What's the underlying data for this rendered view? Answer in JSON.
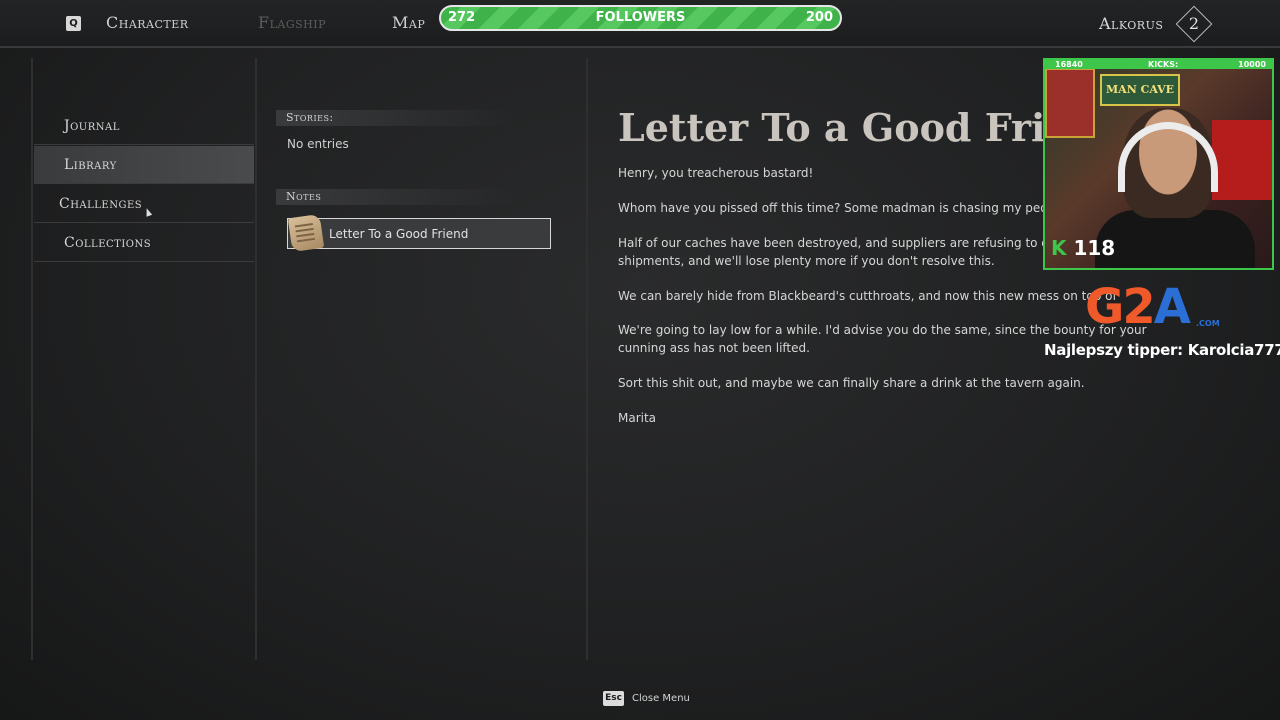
{
  "topbar": {
    "q_key": "Q",
    "tabs": [
      {
        "label": "Character",
        "enabled": true
      },
      {
        "label": "Flagship",
        "enabled": false
      },
      {
        "label": "Map",
        "enabled": true
      }
    ],
    "followers": {
      "left_value": "272",
      "label": "FOLLOWERS",
      "right_value": "200"
    },
    "player_name": "Alkorus",
    "player_level": "2"
  },
  "sidebar": {
    "items": [
      {
        "label": "Journal",
        "active": false
      },
      {
        "label": "Library",
        "active": true
      },
      {
        "label": "Challenges",
        "active": false
      },
      {
        "label": "Collections",
        "active": false
      }
    ]
  },
  "library": {
    "stories_header": "Stories:",
    "stories_empty": "No entries",
    "notes_header": "Notes",
    "notes": [
      {
        "label": "Letter To a Good Friend",
        "icon": "scroll-icon"
      }
    ]
  },
  "letter": {
    "title": "Letter To a Good Friend",
    "paragraphs": [
      "Henry, you treacherous bastard!",
      "Whom have you pissed off this time? Some madman is chasing my people",
      "Half of our caches have been destroyed, and suppliers are refusing to dea dozens of shipments, and we'll lose plenty more if you don't resolve this.",
      "We can barely hide from Blackbeard's cutthroats, and now this new mess on top of",
      "We're going to lay low for a while. I'd advise you do the same, since the bounty for your cunning ass has not been lifted.",
      "Sort this shit out, and maybe we can finally share a drink at the tavern again.",
      "Marita"
    ]
  },
  "stream_overlay": {
    "cam_left": "16840",
    "cam_label": "KICKS:",
    "cam_right": "10000",
    "mancave_sign": "MAN CAVE",
    "kick_symbol": "K",
    "kick_count": "118",
    "sponsor_g2": "G2",
    "sponsor_a": "A",
    "sponsor_com": ".COM",
    "tipper_text": "Najlepszy tipper: Karolcia777"
  },
  "footer": {
    "esc_key": "Esc",
    "close_label": "Close Menu"
  },
  "colors": {
    "followers_green": "#3fb24a",
    "g2a_orange": "#f0592a",
    "g2a_blue": "#2b6fd6",
    "kick_green": "#3ec64a"
  }
}
